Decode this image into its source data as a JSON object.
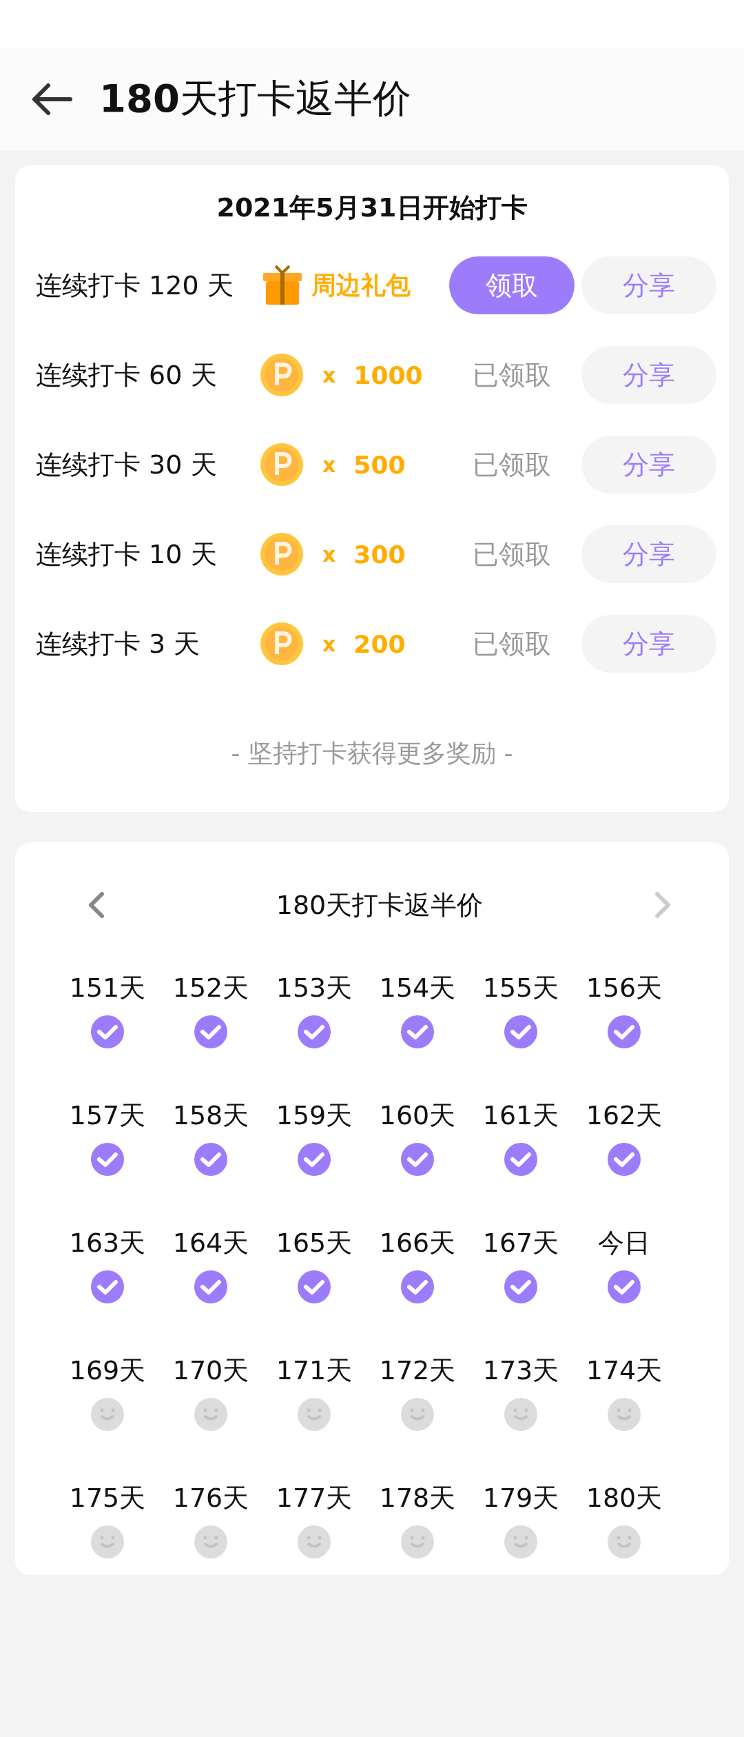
{
  "header": {
    "title": "**180**天打卡返半价"
  },
  "rewards_card": {
    "title": "2021年5月31日开始打卡",
    "rewards": [
      {
        "label": "连续打卡 120 天",
        "kind": "gift",
        "reward": "周边礼包",
        "claimed": false,
        "claim_label": "领取",
        "share_label": "分享"
      },
      {
        "label": "连续打卡 60 天",
        "kind": "coin",
        "multiplier": "x",
        "reward": "1000",
        "claimed": true,
        "claim_label": "已领取",
        "share_label": "分享"
      },
      {
        "label": "连续打卡 30 天",
        "kind": "coin",
        "multiplier": "x",
        "reward": "500",
        "claimed": true,
        "claim_label": "已领取",
        "share_label": "分享"
      },
      {
        "label": "连续打卡 10 天",
        "kind": "coin",
        "multiplier": "x",
        "reward": "300",
        "claimed": true,
        "claim_label": "已领取",
        "share_label": "分享"
      },
      {
        "label": "连续打卡 3 天",
        "kind": "coin",
        "multiplier": "x",
        "reward": "200",
        "claimed": true,
        "claim_label": "已领取",
        "share_label": "分享"
      }
    ],
    "footer": "- 坚持打卡获得更多奖励 -"
  },
  "calendar": {
    "title": "180天打卡返半价",
    "prev_disabled": false,
    "next_disabled": true,
    "days": [
      {
        "label": "151天",
        "checked": true
      },
      {
        "label": "152天",
        "checked": true
      },
      {
        "label": "153天",
        "checked": true
      },
      {
        "label": "154天",
        "checked": true
      },
      {
        "label": "155天",
        "checked": true
      },
      {
        "label": "156天",
        "checked": true
      },
      {
        "label": "157天",
        "checked": true
      },
      {
        "label": "158天",
        "checked": true
      },
      {
        "label": "159天",
        "checked": true
      },
      {
        "label": "160天",
        "checked": true
      },
      {
        "label": "161天",
        "checked": true
      },
      {
        "label": "162天",
        "checked": true
      },
      {
        "label": "163天",
        "checked": true
      },
      {
        "label": "164天",
        "checked": true
      },
      {
        "label": "165天",
        "checked": true
      },
      {
        "label": "166天",
        "checked": true
      },
      {
        "label": "167天",
        "checked": true
      },
      {
        "label": "今日",
        "checked": true
      },
      {
        "label": "169天",
        "checked": false
      },
      {
        "label": "170天",
        "checked": false
      },
      {
        "label": "171天",
        "checked": false
      },
      {
        "label": "172天",
        "checked": false
      },
      {
        "label": "173天",
        "checked": false
      },
      {
        "label": "174天",
        "checked": false
      },
      {
        "label": "175天",
        "checked": false
      },
      {
        "label": "176天",
        "checked": false
      },
      {
        "label": "177天",
        "checked": false
      },
      {
        "label": "178天",
        "checked": false
      },
      {
        "label": "179天",
        "checked": false
      },
      {
        "label": "180天",
        "checked": false
      }
    ]
  }
}
